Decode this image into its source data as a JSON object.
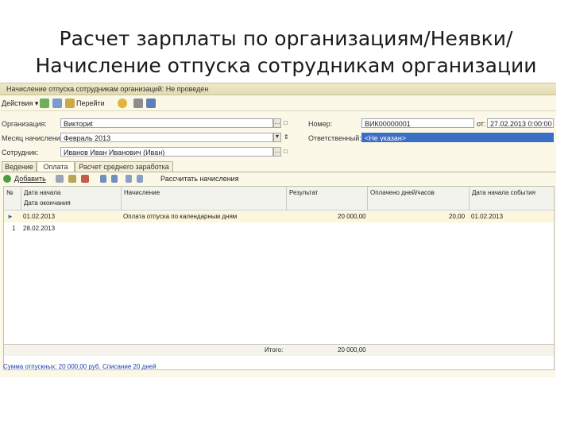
{
  "slide": {
    "title_line1": "Расчет зарплаты по организациям/Неявки/",
    "title_line2": "Начисление отпуска сотрудникам организации"
  },
  "window": {
    "title": "Начисление отпуска сотрудникам организаций: Не проведен"
  },
  "toolbar": {
    "actions_label": "Действия ▾",
    "goto_label": "Перейти"
  },
  "form": {
    "organization_label": "Организация:",
    "organization_value": "Викториt",
    "month_label": "Месяц начисления:",
    "month_value": "Февраль 2013",
    "employee_label": "Сотрудник:",
    "employee_value": "Иванов Иван Иванович (Иван)",
    "number_label": "Номер:",
    "number_value": "ВИК00000001",
    "date_label": "от:",
    "date_value": "27.02.2013 0:00:00",
    "responsible_label": "Ответственный:",
    "responsible_value": "<Не указан>"
  },
  "tabs": [
    {
      "label": "Ведение"
    },
    {
      "label": "Оплата"
    },
    {
      "label": "Расчет среднего заработка"
    }
  ],
  "subtoolbar": {
    "add_label": "Добавить",
    "calc_label": "Рассчитать начисления"
  },
  "table": {
    "headers": {
      "num": "№",
      "date_start": "Дата начала",
      "date_end": "Дата окончания",
      "accrual": "Начисление",
      "result": "Результат",
      "days_paid": "Оплачено дней/часов",
      "event_start": "Дата начала события"
    },
    "rows": [
      {
        "num": "1",
        "date_start": "01.02.2013",
        "date_end": "28.02.2013",
        "accrual": "Оплата отпуска по календарным дням",
        "result": "20 000,00",
        "days_paid": "20,00",
        "event_start": "01.02.2013"
      }
    ],
    "footer": {
      "total_label": "Итого:",
      "total_value": "20 000,00"
    }
  },
  "status": {
    "text": "Сумма отпускных: 20 000,00 руб. Списание 20 дней"
  },
  "colors": {
    "window_bg": "#fbf8e8",
    "selection_blue": "#3a6ec4",
    "status_link": "#1a3ea6"
  }
}
